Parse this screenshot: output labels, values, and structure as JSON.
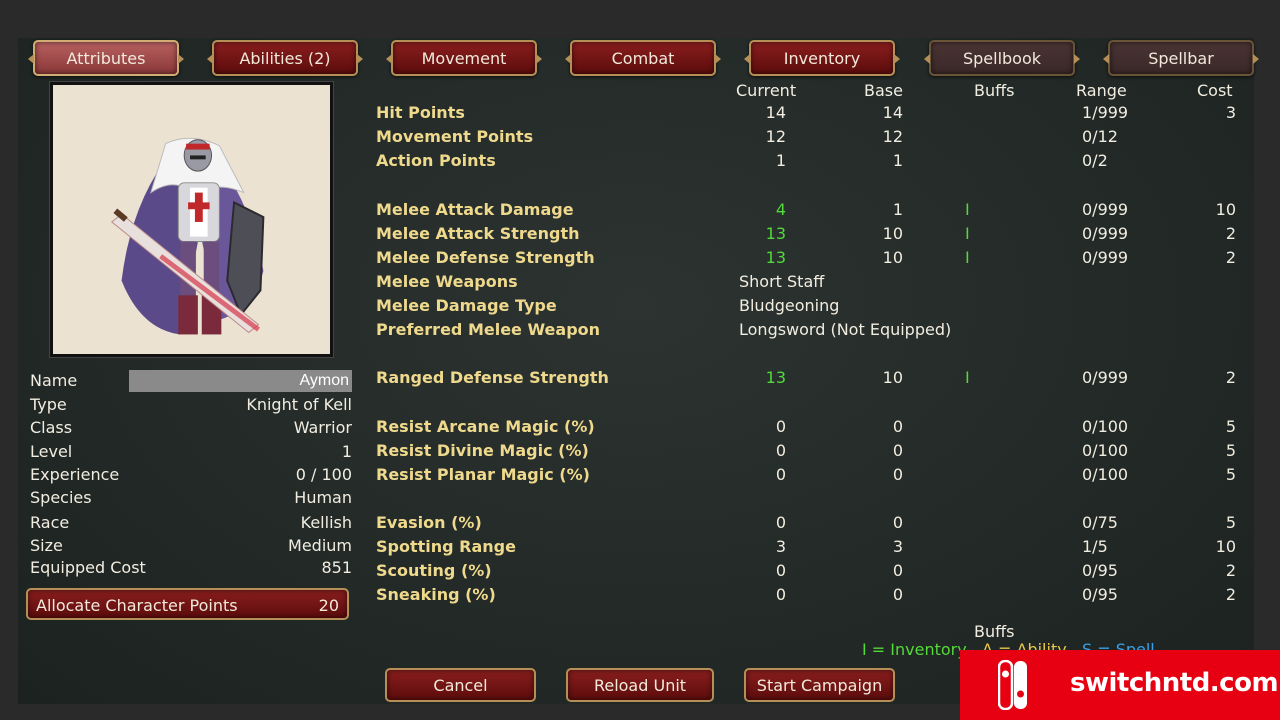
{
  "tabs": [
    {
      "label": "Attributes",
      "state": "active"
    },
    {
      "label": "Abilities (2)",
      "state": "normal"
    },
    {
      "label": "Movement",
      "state": "normal"
    },
    {
      "label": "Combat",
      "state": "normal"
    },
    {
      "label": "Inventory",
      "state": "normal"
    },
    {
      "label": "Spellbook",
      "state": "dim"
    },
    {
      "label": "Spellbar",
      "state": "dim"
    }
  ],
  "character": {
    "name_label": "Name",
    "name_value": "Aymon",
    "rows": [
      {
        "label": "Type",
        "value": "Knight of Kell"
      },
      {
        "label": "Class",
        "value": "Warrior"
      },
      {
        "label": "Level",
        "value": "1"
      },
      {
        "label": "Experience",
        "value": "0 / 100"
      },
      {
        "label": "Species",
        "value": "Human"
      },
      {
        "label": "Race",
        "value": "Kellish"
      },
      {
        "label": "Size",
        "value": "Medium"
      },
      {
        "label": "Equipped Cost",
        "value": "851"
      }
    ],
    "allocate_label": "Allocate Character Points",
    "allocate_value": "20"
  },
  "stats_headers": {
    "current": "Current",
    "base": "Base",
    "buffs": "Buffs",
    "range": "Range",
    "cost": "Cost"
  },
  "stats": [
    {
      "name": "Hit Points",
      "current": "14",
      "base": "14",
      "buff": "",
      "range": "1/999",
      "cost": "3"
    },
    {
      "name": "Movement Points",
      "current": "12",
      "base": "12",
      "buff": "",
      "range": "0/12",
      "cost": ""
    },
    {
      "name": "Action Points",
      "current": "1",
      "base": "1",
      "buff": "",
      "range": "0/2",
      "cost": ""
    },
    {
      "name": "Melee Attack Damage",
      "current": "4",
      "current_green": true,
      "base": "1",
      "buff": "I",
      "range": "0/999",
      "cost": "10"
    },
    {
      "name": "Melee Attack Strength",
      "current": "13",
      "current_green": true,
      "base": "10",
      "buff": "I",
      "range": "0/999",
      "cost": "2"
    },
    {
      "name": "Melee Defense Strength",
      "current": "13",
      "current_green": true,
      "base": "10",
      "buff": "I",
      "range": "0/999",
      "cost": "2"
    },
    {
      "name": "Melee Weapons",
      "current": "Short Staff",
      "is_text": true,
      "base": "",
      "buff": "",
      "range": "",
      "cost": ""
    },
    {
      "name": "Melee Damage Type",
      "current": "Bludgeoning",
      "is_text": true,
      "base": "",
      "buff": "",
      "range": "",
      "cost": ""
    },
    {
      "name": "Preferred Melee Weapon",
      "current": "Longsword (Not Equipped)",
      "is_text": true,
      "base": "",
      "buff": "",
      "range": "",
      "cost": ""
    },
    {
      "name": "Ranged Defense Strength",
      "current": "13",
      "current_green": true,
      "base": "10",
      "buff": "I",
      "range": "0/999",
      "cost": "2"
    },
    {
      "name": "Resist Arcane Magic (%)",
      "current": "0",
      "base": "0",
      "buff": "",
      "range": "0/100",
      "cost": "5"
    },
    {
      "name": "Resist Divine Magic (%)",
      "current": "0",
      "base": "0",
      "buff": "",
      "range": "0/100",
      "cost": "5"
    },
    {
      "name": "Resist Planar Magic (%)",
      "current": "0",
      "base": "0",
      "buff": "",
      "range": "0/100",
      "cost": "5"
    },
    {
      "name": "Evasion (%)",
      "current": "0",
      "base": "0",
      "buff": "",
      "range": "0/75",
      "cost": "5"
    },
    {
      "name": "Spotting Range",
      "current": "3",
      "base": "3",
      "buff": "",
      "range": "1/5",
      "cost": "10"
    },
    {
      "name": "Scouting (%)",
      "current": "0",
      "base": "0",
      "buff": "",
      "range": "0/95",
      "cost": "2"
    },
    {
      "name": "Sneaking (%)",
      "current": "0",
      "base": "0",
      "buff": "",
      "range": "0/95",
      "cost": "2"
    }
  ],
  "buffs_legend": {
    "title": "Buffs",
    "inventory": "I = Inventory",
    "ability": "A = Ability",
    "spell": "S = Spell"
  },
  "buttons": {
    "cancel": "Cancel",
    "reload": "Reload Unit",
    "start": "Start Campaign"
  },
  "watermark": {
    "text": "switchntd.com"
  },
  "colors": {
    "accent_red": "#7a1414",
    "gold_border": "#b58f56",
    "stat_name": "#efd98c",
    "buff_green": "#54d93a"
  }
}
